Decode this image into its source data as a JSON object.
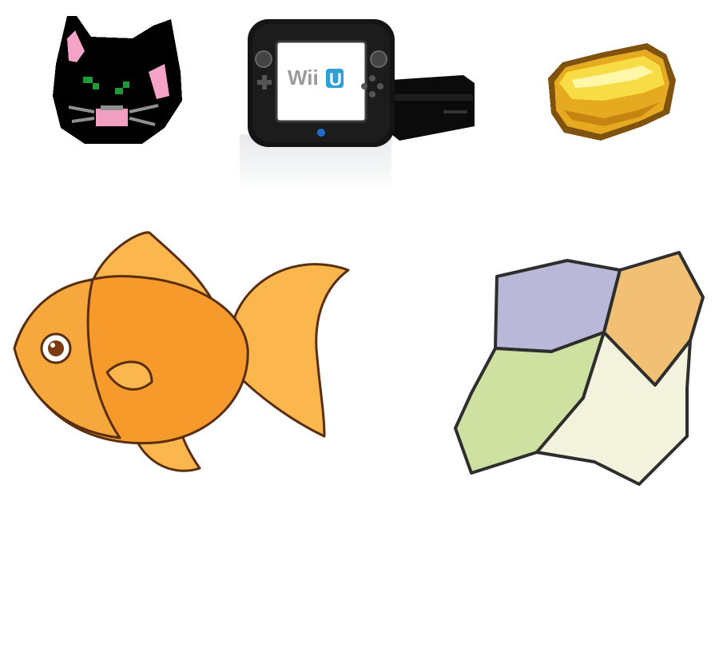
{
  "scene": {
    "background": "#ffffff",
    "items": [
      {
        "id": "cat",
        "icon": "pixel-black-cat-head-icon",
        "colors": [
          "#000000",
          "#ff9ccc",
          "#1fa83a",
          "#8c8c8c"
        ]
      },
      {
        "id": "wiiu",
        "icon": "wii-u-console-icon",
        "logo_text": "Wii",
        "logo_badge": "U",
        "logo_color": "#2f9fd8"
      },
      {
        "id": "gold",
        "icon": "pixel-gold-ingot-icon",
        "colors": [
          "#f5d23a",
          "#fff6a6",
          "#c98c14",
          "#8a5a10"
        ]
      },
      {
        "id": "fish",
        "icon": "goldfish-icon",
        "colors": [
          "#f7962a",
          "#fbc469",
          "#e06f12",
          "#5a2e0c"
        ]
      },
      {
        "id": "puzzle",
        "icon": "jigsaw-puzzle-icon",
        "colors": [
          "#b9b8d8",
          "#f1c074",
          "#cfe1a0",
          "#f3f2dc"
        ]
      }
    ]
  }
}
